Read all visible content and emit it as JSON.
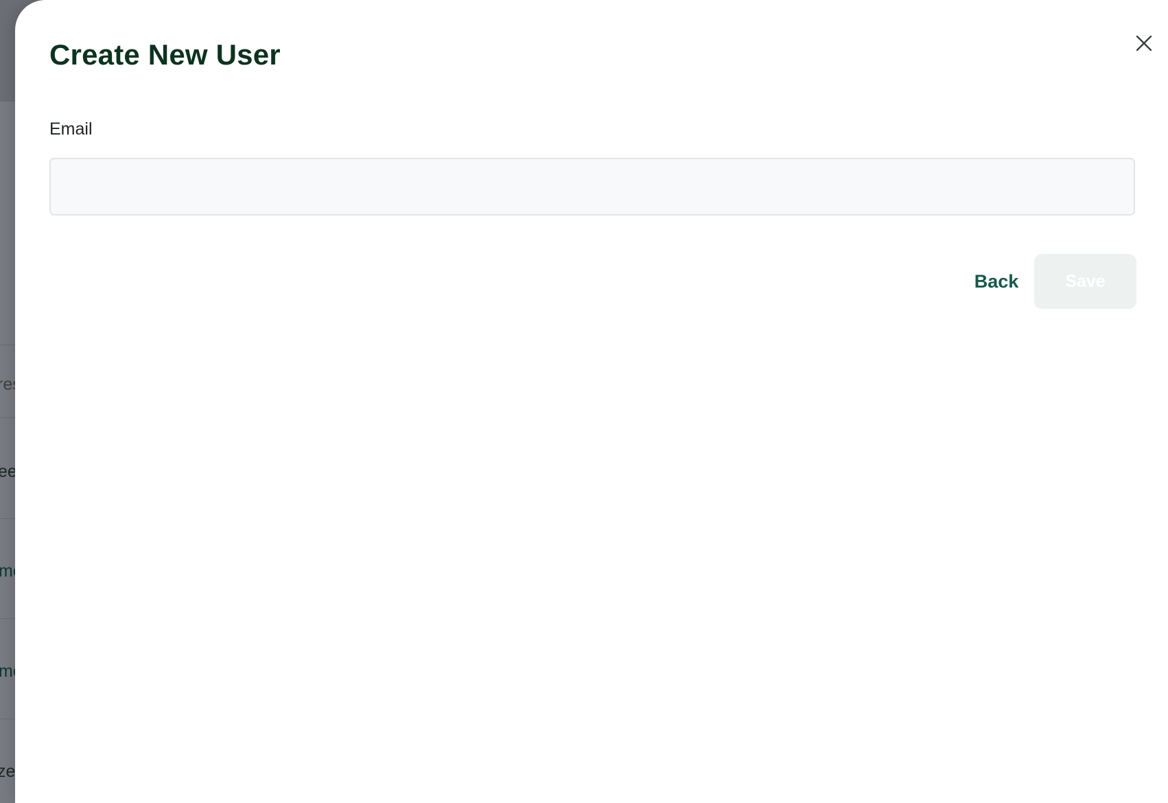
{
  "background_page": {
    "rows": [
      {
        "text": "res",
        "style": "muted"
      },
      {
        "text": "ee",
        "style": "dark"
      },
      {
        "text": "mc",
        "style": "green"
      },
      {
        "text": "mc",
        "style": "green"
      },
      {
        "text": "ze",
        "style": "dark"
      }
    ]
  },
  "modal": {
    "title": "Create New User",
    "close_icon": "close-icon",
    "email": {
      "label": "Email",
      "value": "",
      "placeholder": ""
    },
    "actions": {
      "back_label": "Back",
      "save_label": "Save",
      "save_disabled": true
    }
  },
  "colors": {
    "title": "#0d3320",
    "back_button_text": "#14594a",
    "save_button_bg_disabled": "#edf2f1",
    "input_bg": "#f8f9fb",
    "input_border": "#e2e5e8",
    "overlay": "#787b83"
  }
}
